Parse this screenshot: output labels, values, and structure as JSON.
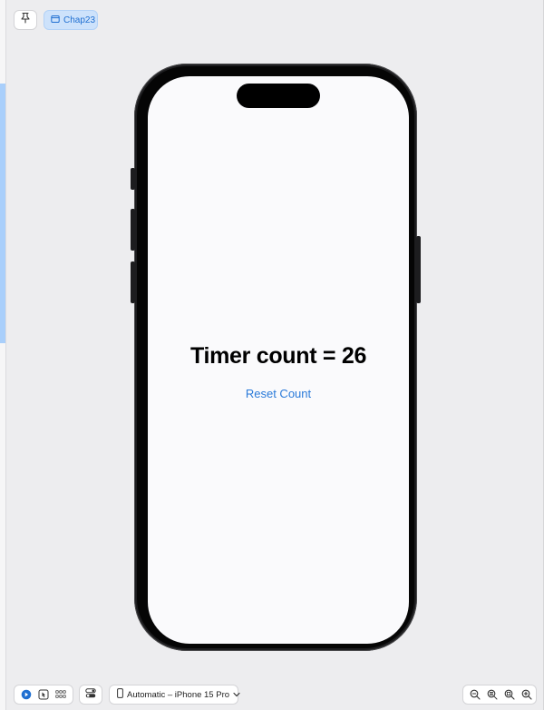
{
  "top": {
    "pin_icon": "pin-icon",
    "chip_label": "Chap23",
    "chip_icon": "preview-window-icon"
  },
  "screen": {
    "timer_text": "Timer count = 26",
    "reset_label": "Reset Count"
  },
  "toolbar": {
    "device_label": "Automatic – iPhone 15 Pro",
    "icons": [
      "live-preview-icon",
      "selectable-icon",
      "variants-grid-icon",
      "device-settings-icon",
      "phone-icon",
      "chevron-down-icon",
      "zoom-out-icon",
      "zoom-to-fit-icon",
      "zoom-100-icon",
      "zoom-in-icon"
    ]
  },
  "colors": {
    "accent": "#2a7ad9",
    "chip_bg": "#cde2fb",
    "canvas_bg": "#ededef",
    "screen_bg": "#fafafc"
  }
}
